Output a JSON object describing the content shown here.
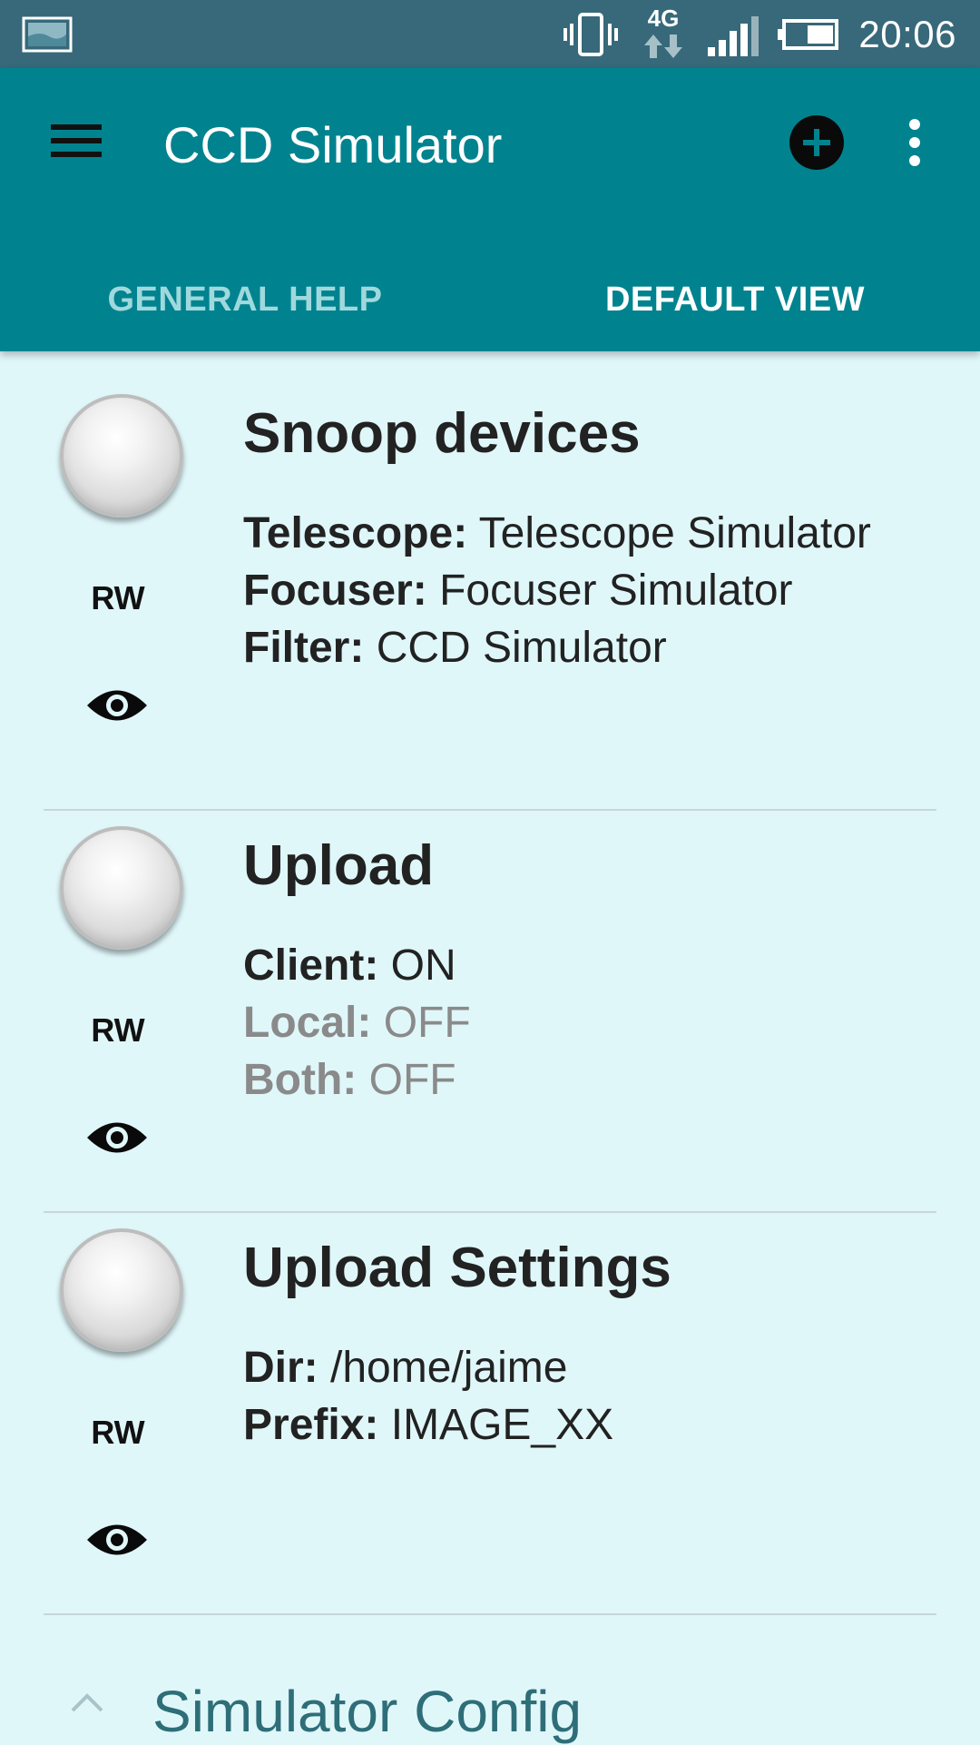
{
  "status_bar": {
    "time": "20:06",
    "network_label": "4G",
    "icons": [
      "image-thumbnail-icon",
      "vibrate-icon",
      "network-4g-icon",
      "signal-icon",
      "battery-icon"
    ]
  },
  "app_bar": {
    "title": "CCD Simulator",
    "icons": [
      "menu-icon",
      "add-icon",
      "overflow-menu-icon"
    ]
  },
  "tabs": [
    {
      "label": "GENERAL HELP",
      "selected": false
    },
    {
      "label": "DEFAULT VIEW",
      "selected": true
    }
  ],
  "properties": [
    {
      "title": "Snoop devices",
      "permission": "RW",
      "items": [
        {
          "key": "Telescope:",
          "value": "Telescope Simulator",
          "active": true
        },
        {
          "key": "Focuser:",
          "value": "Focuser Simulator",
          "active": true
        },
        {
          "key": "Filter:",
          "value": "CCD Simulator",
          "active": true
        }
      ]
    },
    {
      "title": "Upload",
      "permission": "RW",
      "items": [
        {
          "key": "Client:",
          "value": "ON",
          "active": true
        },
        {
          "key": "Local:",
          "value": "OFF",
          "active": false
        },
        {
          "key": "Both:",
          "value": "OFF",
          "active": false
        }
      ]
    },
    {
      "title": "Upload Settings",
      "permission": "RW",
      "items": [
        {
          "key": "Dir:",
          "value": "/home/jaime",
          "active": true
        },
        {
          "key": "Prefix:",
          "value": "IMAGE_XX",
          "active": true
        }
      ]
    }
  ],
  "section": {
    "title": "Simulator Config",
    "expanded": true
  },
  "colors": {
    "status_bar": "#37697a",
    "app_bar": "#00838f",
    "background": "#e0f7fa",
    "inactive_tab": "#9fd9dd",
    "section_title": "#2e6e78"
  }
}
